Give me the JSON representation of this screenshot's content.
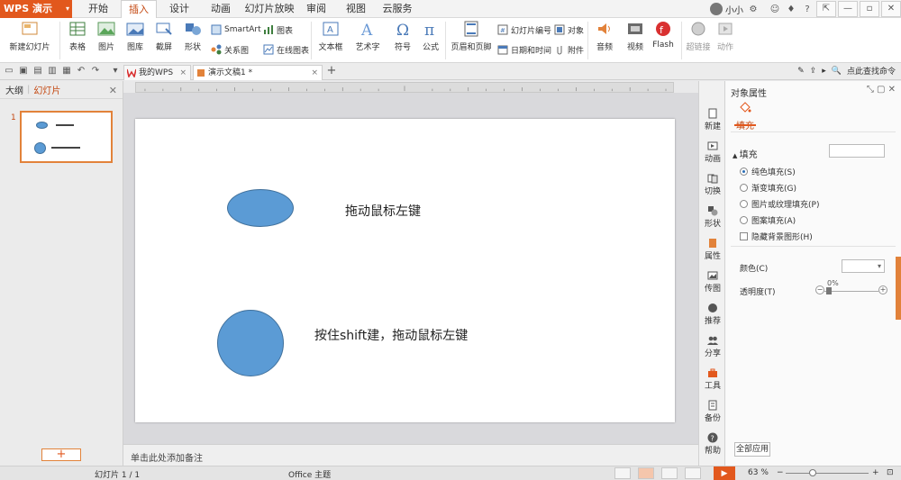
{
  "app": {
    "name": "WPS 演示"
  },
  "menu_tabs": [
    {
      "label": "开始"
    },
    {
      "label": "插入"
    },
    {
      "label": "设计"
    },
    {
      "label": "动画"
    },
    {
      "label": "幻灯片放映"
    },
    {
      "label": "审阅"
    },
    {
      "label": "视图"
    },
    {
      "label": "云服务"
    }
  ],
  "user": {
    "name": "小小"
  },
  "ribbon": {
    "new_slide": "新建幻灯片",
    "table": "表格",
    "image": "图片",
    "gallery": "图库",
    "screenshot": "截屏",
    "shapes": "形状",
    "smartart": "SmartArt",
    "chart": "图表",
    "relation": "关系图",
    "online_chart": "在线图表",
    "textbox": "文本框",
    "wordart": "艺术字",
    "symbol": "符号",
    "formula": "公式",
    "header_footer": "页眉和页脚",
    "slide_number": "幻灯片编号",
    "object": "对象",
    "date_time": "日期和时间",
    "attachment": "附件",
    "audio": "音频",
    "video": "视频",
    "flash": "Flash",
    "hyperlink": "超链接",
    "action": "动作"
  },
  "doc_tabs": [
    {
      "label": "我的WPS"
    },
    {
      "label": "演示文稿1 *"
    }
  ],
  "command_search": "点此查找命令",
  "left_panel": {
    "tab_outline": "大纲",
    "tab_slides": "幻灯片",
    "slide_number": "1"
  },
  "slide": {
    "text1": "拖动鼠标左键",
    "text2": "按住shift建，拖动鼠标左键"
  },
  "notes": "单击此处添加备注",
  "side_tabs": [
    {
      "label": "新建"
    },
    {
      "label": "动画"
    },
    {
      "label": "切换"
    },
    {
      "label": "形状"
    },
    {
      "label": "属性"
    },
    {
      "label": "传图"
    },
    {
      "label": "推荐"
    },
    {
      "label": "分享"
    },
    {
      "label": "工具"
    },
    {
      "label": "备份"
    },
    {
      "label": "帮助"
    }
  ],
  "properties": {
    "title": "对象属性",
    "fill_tab": "填充",
    "section": "填充",
    "options": [
      {
        "label": "纯色填充(S)"
      },
      {
        "label": "渐变填充(G)"
      },
      {
        "label": "图片或纹理填充(P)"
      },
      {
        "label": "图案填充(A)"
      }
    ],
    "hide_bg": "隐藏背景图形(H)",
    "color_label": "颜色(C)",
    "transparency_label": "透明度(T)",
    "transparency_value": "0%",
    "apply_all": "全部应用"
  },
  "status": {
    "slide_info": "幻灯片 1 / 1",
    "theme": "Office 主题",
    "zoom": "63 %"
  },
  "colors": {
    "accent": "#e2581d",
    "shape_fill": "#5b9bd5"
  }
}
